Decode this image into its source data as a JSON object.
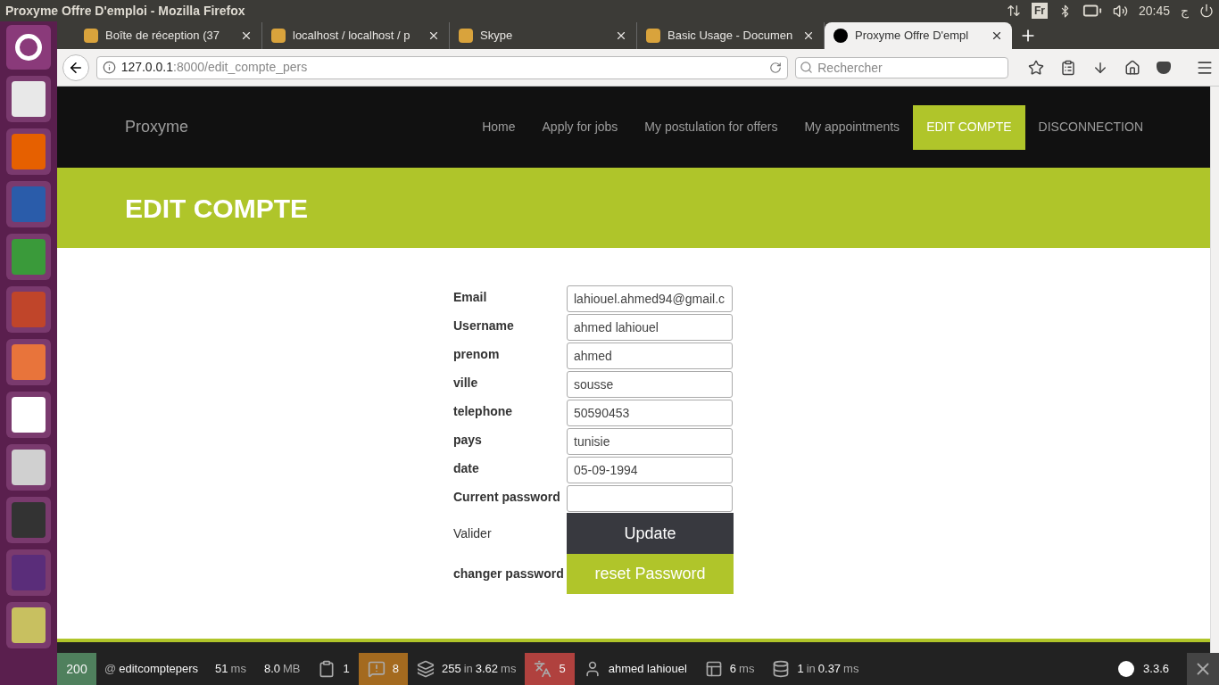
{
  "window": {
    "title": "Proxyme Offre D'emploi - Mozilla Firefox"
  },
  "top_panel": {
    "keyboard": "Fr",
    "time": "20:45",
    "input_method": "ج"
  },
  "tabs": [
    {
      "label": "Boîte de réception (37",
      "selected": false
    },
    {
      "label": "localhost / localhost / p",
      "selected": false
    },
    {
      "label": "Skype",
      "selected": false
    },
    {
      "label": "Basic Usage - Documen",
      "selected": false
    },
    {
      "label": "Proxyme Offre D'empl",
      "selected": true
    }
  ],
  "address_bar": {
    "host": "127.0.0.1",
    "path": ":8000/edit_compte_pers"
  },
  "search": {
    "placeholder": "Rechercher"
  },
  "site": {
    "brand": "Proxyme",
    "nav": [
      {
        "label": "Home",
        "selected": false
      },
      {
        "label": "Apply for jobs",
        "selected": false
      },
      {
        "label": "My postulation for offers",
        "selected": false
      },
      {
        "label": "My appointments",
        "selected": false
      },
      {
        "label": "EDIT COMPTE",
        "selected": true
      },
      {
        "label": "DISCONNECTION",
        "selected": false
      }
    ],
    "banner_title": "EDIT COMPTE"
  },
  "form": [
    {
      "kind": "field",
      "label": "Email",
      "value": "lahiouel.ahmed94@gmail.c"
    },
    {
      "kind": "field",
      "label": "Username",
      "value": "ahmed lahiouel"
    },
    {
      "kind": "field",
      "label": "prenom",
      "value": "ahmed"
    },
    {
      "kind": "field",
      "label": "ville",
      "value": "sousse"
    },
    {
      "kind": "field",
      "label": "telephone",
      "value": "50590453"
    },
    {
      "kind": "field",
      "label": "pays",
      "value": "tunisie"
    },
    {
      "kind": "field",
      "label": "date",
      "value": "05-09-1994"
    },
    {
      "kind": "field",
      "label": "Current password"
    },
    {
      "kind": "dark_button",
      "label": "Valider",
      "button": "Update"
    },
    {
      "kind": "green_button",
      "label": "changer password",
      "button": "reset Password"
    }
  ],
  "debug_toolbar": {
    "status": "200",
    "route": [
      {
        "text": "@",
        "muted": true
      },
      {
        "text": "editcomptepers",
        "muted": false
      }
    ],
    "items": [
      {
        "kind": "plain",
        "parts": [
          {
            "text": "51",
            "muted": false
          },
          {
            "text": "ms",
            "muted": true
          }
        ]
      },
      {
        "kind": "plain",
        "parts": [
          {
            "text": "8.0",
            "muted": false
          },
          {
            "text": "MB",
            "muted": true
          }
        ]
      },
      {
        "kind": "clipboard",
        "parts": [
          {
            "text": "1",
            "muted": false
          }
        ]
      },
      {
        "kind": "warning",
        "parts": [
          {
            "text": "8",
            "muted": false
          }
        ]
      },
      {
        "kind": "layers",
        "parts": [
          {
            "text": "255",
            "muted": false
          },
          {
            "text": "in",
            "muted": true
          },
          {
            "text": "3.62",
            "muted": false
          },
          {
            "text": "ms",
            "muted": true
          }
        ]
      },
      {
        "kind": "translation",
        "parts": [
          {
            "text": "5",
            "muted": false
          }
        ]
      },
      {
        "kind": "user",
        "parts": [
          {
            "text": "ahmed lahiouel",
            "muted": false
          }
        ]
      },
      {
        "kind": "layout",
        "parts": [
          {
            "text": "6",
            "muted": false
          },
          {
            "text": "ms",
            "muted": true
          }
        ]
      },
      {
        "kind": "database",
        "parts": [
          {
            "text": "1",
            "muted": false
          },
          {
            "text": "in",
            "muted": true
          },
          {
            "text": "0.37",
            "muted": false
          },
          {
            "text": "ms",
            "muted": true
          }
        ]
      }
    ],
    "version": "3.3.6"
  }
}
